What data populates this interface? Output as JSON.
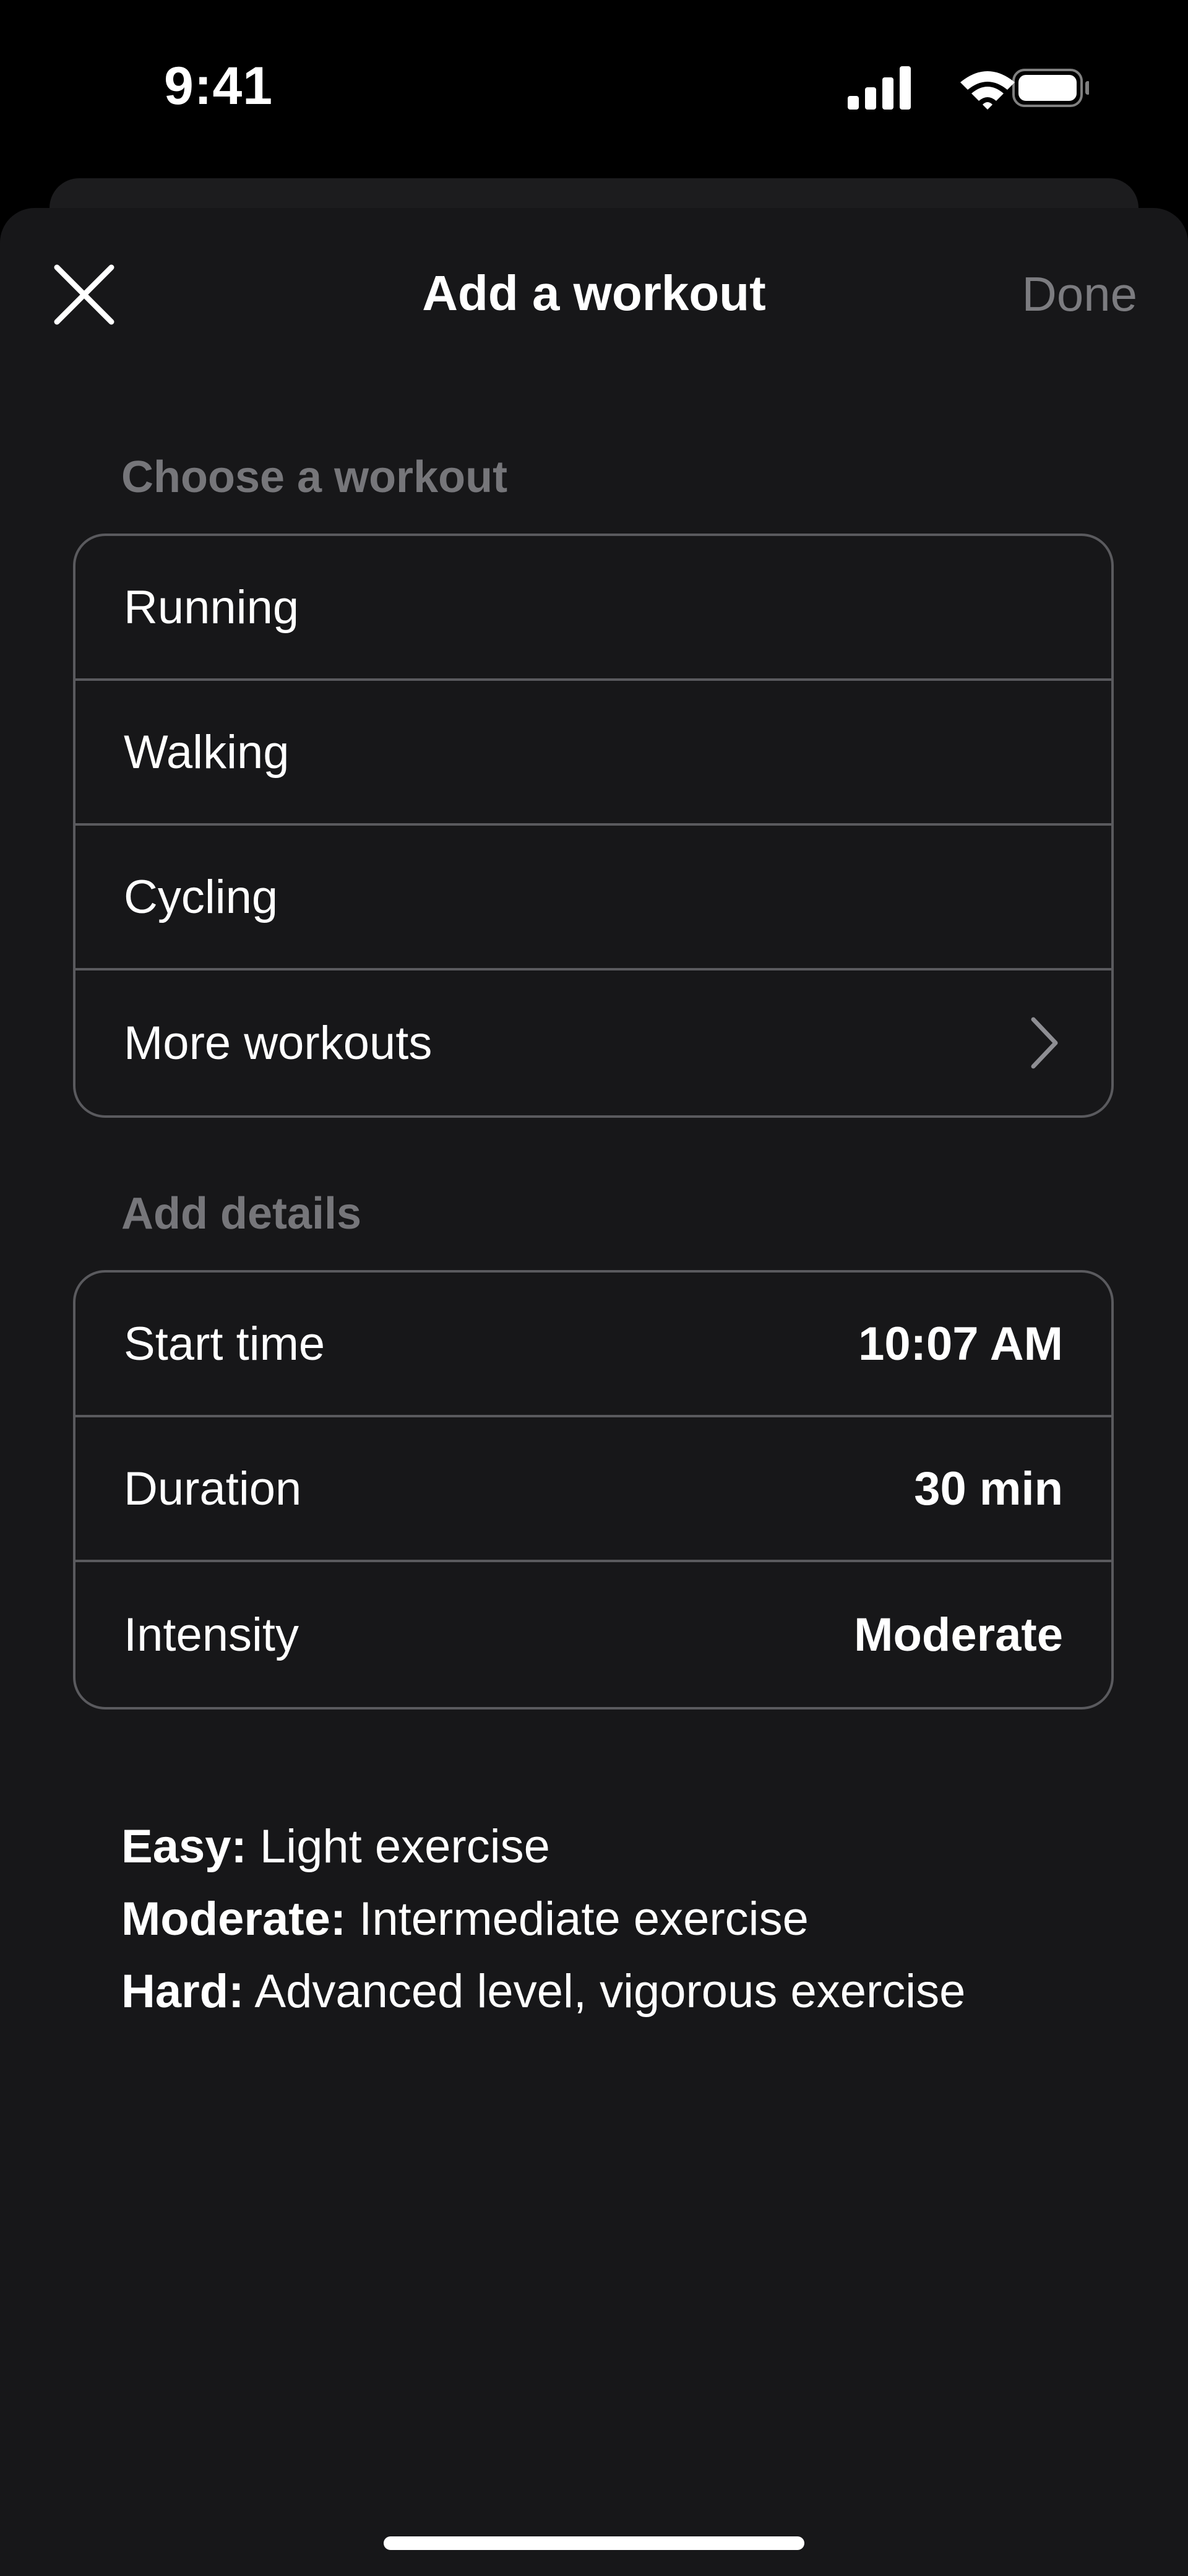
{
  "status_bar": {
    "time": "9:41",
    "icons": [
      "cellular-signal-icon",
      "wifi-icon",
      "battery-icon"
    ]
  },
  "nav": {
    "close_icon": "close-icon",
    "title": "Add a workout",
    "done_label": "Done"
  },
  "choose_section": {
    "heading": "Choose a workout",
    "items": [
      {
        "label": "Running"
      },
      {
        "label": "Walking"
      },
      {
        "label": "Cycling"
      },
      {
        "label": "More workouts",
        "icon": "chevron-right-icon"
      }
    ]
  },
  "details_section": {
    "heading": "Add details",
    "rows": [
      {
        "label": "Start time",
        "value": "10:07 AM"
      },
      {
        "label": "Duration",
        "value": "30 min"
      },
      {
        "label": "Intensity",
        "value": "Moderate"
      }
    ]
  },
  "legend": [
    {
      "term": "Easy:",
      "desc": " Light exercise"
    },
    {
      "term": "Moderate:",
      "desc": " Intermediate exercise"
    },
    {
      "term": "Hard:",
      "desc": " Advanced level, vigorous exercise"
    }
  ],
  "colors": {
    "background": "#000000",
    "sheet": "#171719",
    "border": "#5a5a5e",
    "muted_text": "#76767a",
    "text": "#ffffff"
  }
}
